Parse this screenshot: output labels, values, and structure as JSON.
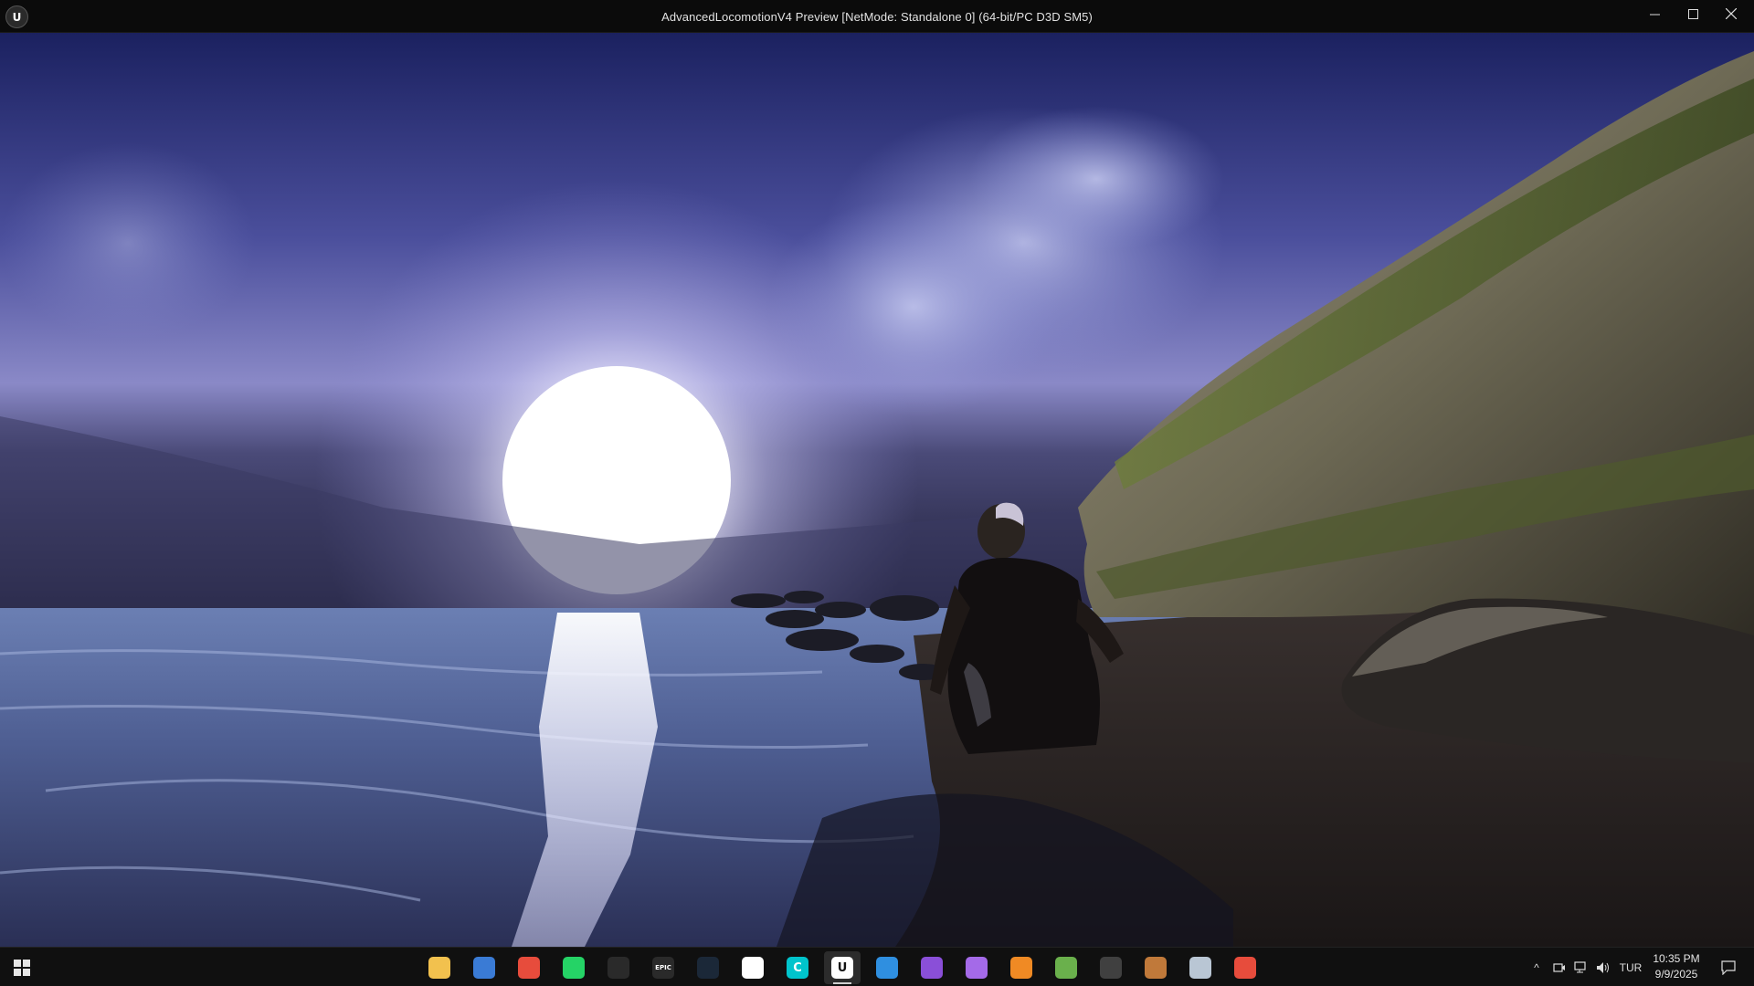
{
  "window": {
    "title": "AdvancedLocomotionV4 Preview [NetMode: Standalone 0]  (64-bit/PC D3D SM5)",
    "app_logo_text": "U",
    "minimize_glyph": "—",
    "maximize_glyph": "☐",
    "close_glyph": "✕"
  },
  "scene": {
    "description_name": "moonlit-beach-scene",
    "sky_top": "#1a1f5e",
    "sky_mid": "#6d6fb8",
    "moon_color": "#ffffff",
    "water_color": "#5d6fa0",
    "cliff_color": "#7b7460",
    "sand_color": "#2b2522"
  },
  "taskbar": {
    "apps": [
      {
        "name": "file-explorer",
        "icon": "folder-icon",
        "color": "#f2c14e",
        "glyph": ""
      },
      {
        "name": "microsoft-store",
        "icon": "store-icon",
        "color": "#3a7bd5",
        "glyph": ""
      },
      {
        "name": "google-chrome",
        "icon": "chrome-icon",
        "color": "#e74c3c",
        "glyph": ""
      },
      {
        "name": "whatsapp",
        "icon": "whatsapp-icon",
        "color": "#25d366",
        "glyph": ""
      },
      {
        "name": "chatgpt",
        "icon": "openai-icon",
        "color": "#2a2a2a",
        "glyph": ""
      },
      {
        "name": "epic-games",
        "icon": "epic-games-icon",
        "color": "#2a2a2a",
        "glyph": "EPIC"
      },
      {
        "name": "steam",
        "icon": "steam-icon",
        "color": "#1b2838",
        "glyph": ""
      },
      {
        "name": "capcut",
        "icon": "capcut-icon",
        "color": "#ffffff",
        "glyph": ""
      },
      {
        "name": "canva",
        "icon": "canva-icon",
        "color": "#00c4cc",
        "glyph": "C"
      },
      {
        "name": "unreal-engine",
        "icon": "unreal-icon",
        "color": "#ffffff",
        "glyph": "U",
        "active": true
      },
      {
        "name": "vs-code",
        "icon": "vscode-icon",
        "color": "#2f8fe0",
        "glyph": ""
      },
      {
        "name": "visual-studio",
        "icon": "visual-studio-icon",
        "color": "#8a4fd8",
        "glyph": ""
      },
      {
        "name": "visual-studio-preview",
        "icon": "visual-studio-preview-icon",
        "color": "#a46ae8",
        "glyph": ""
      },
      {
        "name": "blender",
        "icon": "blender-icon",
        "color": "#f08a24",
        "glyph": ""
      },
      {
        "name": "android-studio",
        "icon": "android-studio-icon",
        "color": "#6ab04c",
        "glyph": ""
      },
      {
        "name": "obs-studio",
        "icon": "obs-icon",
        "color": "#404040",
        "glyph": ""
      },
      {
        "name": "gimp-tool",
        "icon": "paint-app-icon",
        "color": "#c0793a",
        "glyph": ""
      },
      {
        "name": "disk-utility",
        "icon": "disk-icon",
        "color": "#b9c6d4",
        "glyph": ""
      },
      {
        "name": "color-app",
        "icon": "color-wheel-icon",
        "color": "#e74c3c",
        "glyph": ""
      }
    ],
    "tray": {
      "chevron": "^",
      "language": "TUR",
      "time": "10:35 PM",
      "date": "9/9/2025"
    }
  }
}
